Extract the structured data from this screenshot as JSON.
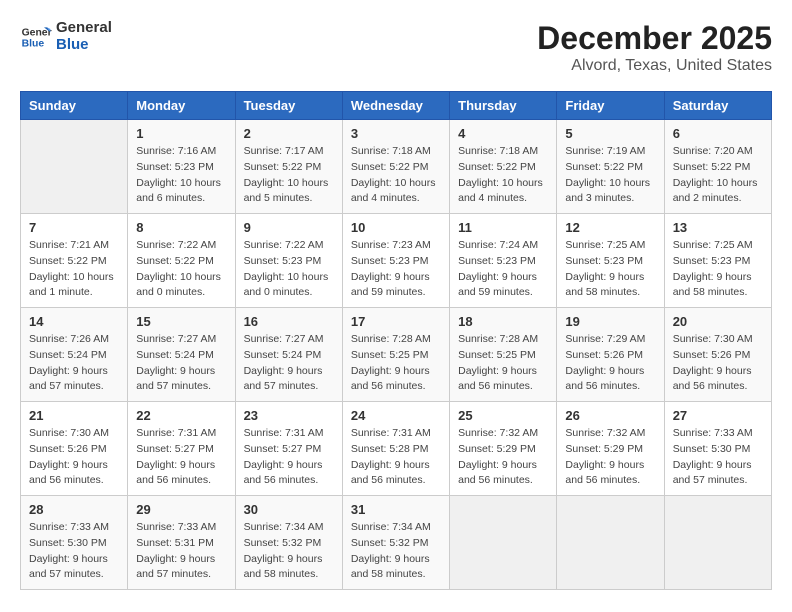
{
  "logo": {
    "line1": "General",
    "line2": "Blue"
  },
  "title": "December 2025",
  "subtitle": "Alvord, Texas, United States",
  "days_header": [
    "Sunday",
    "Monday",
    "Tuesday",
    "Wednesday",
    "Thursday",
    "Friday",
    "Saturday"
  ],
  "weeks": [
    [
      {
        "day": "",
        "info": ""
      },
      {
        "day": "1",
        "info": "Sunrise: 7:16 AM\nSunset: 5:23 PM\nDaylight: 10 hours\nand 6 minutes."
      },
      {
        "day": "2",
        "info": "Sunrise: 7:17 AM\nSunset: 5:22 PM\nDaylight: 10 hours\nand 5 minutes."
      },
      {
        "day": "3",
        "info": "Sunrise: 7:18 AM\nSunset: 5:22 PM\nDaylight: 10 hours\nand 4 minutes."
      },
      {
        "day": "4",
        "info": "Sunrise: 7:18 AM\nSunset: 5:22 PM\nDaylight: 10 hours\nand 4 minutes."
      },
      {
        "day": "5",
        "info": "Sunrise: 7:19 AM\nSunset: 5:22 PM\nDaylight: 10 hours\nand 3 minutes."
      },
      {
        "day": "6",
        "info": "Sunrise: 7:20 AM\nSunset: 5:22 PM\nDaylight: 10 hours\nand 2 minutes."
      }
    ],
    [
      {
        "day": "7",
        "info": "Sunrise: 7:21 AM\nSunset: 5:22 PM\nDaylight: 10 hours\nand 1 minute."
      },
      {
        "day": "8",
        "info": "Sunrise: 7:22 AM\nSunset: 5:22 PM\nDaylight: 10 hours\nand 0 minutes."
      },
      {
        "day": "9",
        "info": "Sunrise: 7:22 AM\nSunset: 5:23 PM\nDaylight: 10 hours\nand 0 minutes."
      },
      {
        "day": "10",
        "info": "Sunrise: 7:23 AM\nSunset: 5:23 PM\nDaylight: 9 hours\nand 59 minutes."
      },
      {
        "day": "11",
        "info": "Sunrise: 7:24 AM\nSunset: 5:23 PM\nDaylight: 9 hours\nand 59 minutes."
      },
      {
        "day": "12",
        "info": "Sunrise: 7:25 AM\nSunset: 5:23 PM\nDaylight: 9 hours\nand 58 minutes."
      },
      {
        "day": "13",
        "info": "Sunrise: 7:25 AM\nSunset: 5:23 PM\nDaylight: 9 hours\nand 58 minutes."
      }
    ],
    [
      {
        "day": "14",
        "info": "Sunrise: 7:26 AM\nSunset: 5:24 PM\nDaylight: 9 hours\nand 57 minutes."
      },
      {
        "day": "15",
        "info": "Sunrise: 7:27 AM\nSunset: 5:24 PM\nDaylight: 9 hours\nand 57 minutes."
      },
      {
        "day": "16",
        "info": "Sunrise: 7:27 AM\nSunset: 5:24 PM\nDaylight: 9 hours\nand 57 minutes."
      },
      {
        "day": "17",
        "info": "Sunrise: 7:28 AM\nSunset: 5:25 PM\nDaylight: 9 hours\nand 56 minutes."
      },
      {
        "day": "18",
        "info": "Sunrise: 7:28 AM\nSunset: 5:25 PM\nDaylight: 9 hours\nand 56 minutes."
      },
      {
        "day": "19",
        "info": "Sunrise: 7:29 AM\nSunset: 5:26 PM\nDaylight: 9 hours\nand 56 minutes."
      },
      {
        "day": "20",
        "info": "Sunrise: 7:30 AM\nSunset: 5:26 PM\nDaylight: 9 hours\nand 56 minutes."
      }
    ],
    [
      {
        "day": "21",
        "info": "Sunrise: 7:30 AM\nSunset: 5:26 PM\nDaylight: 9 hours\nand 56 minutes."
      },
      {
        "day": "22",
        "info": "Sunrise: 7:31 AM\nSunset: 5:27 PM\nDaylight: 9 hours\nand 56 minutes."
      },
      {
        "day": "23",
        "info": "Sunrise: 7:31 AM\nSunset: 5:27 PM\nDaylight: 9 hours\nand 56 minutes."
      },
      {
        "day": "24",
        "info": "Sunrise: 7:31 AM\nSunset: 5:28 PM\nDaylight: 9 hours\nand 56 minutes."
      },
      {
        "day": "25",
        "info": "Sunrise: 7:32 AM\nSunset: 5:29 PM\nDaylight: 9 hours\nand 56 minutes."
      },
      {
        "day": "26",
        "info": "Sunrise: 7:32 AM\nSunset: 5:29 PM\nDaylight: 9 hours\nand 56 minutes."
      },
      {
        "day": "27",
        "info": "Sunrise: 7:33 AM\nSunset: 5:30 PM\nDaylight: 9 hours\nand 57 minutes."
      }
    ],
    [
      {
        "day": "28",
        "info": "Sunrise: 7:33 AM\nSunset: 5:30 PM\nDaylight: 9 hours\nand 57 minutes."
      },
      {
        "day": "29",
        "info": "Sunrise: 7:33 AM\nSunset: 5:31 PM\nDaylight: 9 hours\nand 57 minutes."
      },
      {
        "day": "30",
        "info": "Sunrise: 7:34 AM\nSunset: 5:32 PM\nDaylight: 9 hours\nand 58 minutes."
      },
      {
        "day": "31",
        "info": "Sunrise: 7:34 AM\nSunset: 5:32 PM\nDaylight: 9 hours\nand 58 minutes."
      },
      {
        "day": "",
        "info": ""
      },
      {
        "day": "",
        "info": ""
      },
      {
        "day": "",
        "info": ""
      }
    ]
  ]
}
